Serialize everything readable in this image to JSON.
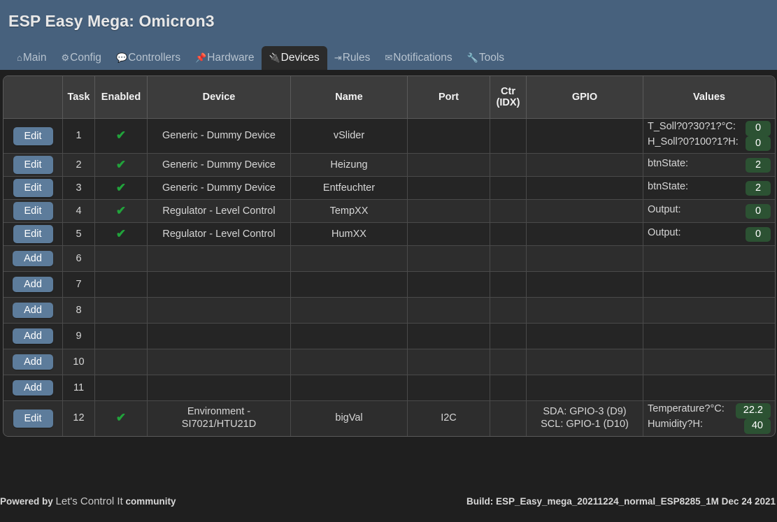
{
  "header": {
    "title": "ESP Easy Mega: Omicron3",
    "nav": [
      {
        "label": "Main",
        "icon": "home-icon",
        "glyph": "⌂",
        "active": false
      },
      {
        "label": "Config",
        "icon": "gear-icon",
        "glyph": "⚙",
        "active": false
      },
      {
        "label": "Controllers",
        "icon": "speech-bubble-icon",
        "glyph": "💬",
        "active": false
      },
      {
        "label": "Hardware",
        "icon": "pushpin-icon",
        "glyph": "📌",
        "active": false
      },
      {
        "label": "Devices",
        "icon": "plug-icon",
        "glyph": "🔌",
        "active": true
      },
      {
        "label": "Rules",
        "icon": "arrow-branch-icon",
        "glyph": "⇥",
        "active": false
      },
      {
        "label": "Notifications",
        "icon": "envelope-icon",
        "glyph": "✉",
        "active": false
      },
      {
        "label": "Tools",
        "icon": "wrench-icon",
        "glyph": "🔧",
        "active": false
      }
    ]
  },
  "table": {
    "columns": [
      {
        "key": "action",
        "label": ""
      },
      {
        "key": "task",
        "label": "Task"
      },
      {
        "key": "enabled",
        "label": "Enabled"
      },
      {
        "key": "device",
        "label": "Device"
      },
      {
        "key": "name",
        "label": "Name"
      },
      {
        "key": "port",
        "label": "Port"
      },
      {
        "key": "ctr",
        "label": "Ctr\n(IDX)"
      },
      {
        "key": "gpio",
        "label": "GPIO"
      },
      {
        "key": "values",
        "label": "Values"
      }
    ],
    "ctr_label_line1": "Ctr",
    "ctr_label_line2": "(IDX)",
    "edit_label": "Edit",
    "add_label": "Add",
    "check_glyph": "✔",
    "rows": [
      {
        "action": "Edit",
        "task": "1",
        "enabled": true,
        "device": "Generic - Dummy Device",
        "name": "vSlider",
        "port": "",
        "ctr": "",
        "gpio": "",
        "values": [
          {
            "label": "T_Soll?0?30?1?°C:",
            "value": "0"
          },
          {
            "label": "H_Soll?0?100?1?H:",
            "value": "0"
          }
        ]
      },
      {
        "action": "Edit",
        "task": "2",
        "enabled": true,
        "device": "Generic - Dummy Device",
        "name": "Heizung",
        "port": "",
        "ctr": "",
        "gpio": "",
        "values": [
          {
            "label": "btnState:",
            "value": "2"
          }
        ]
      },
      {
        "action": "Edit",
        "task": "3",
        "enabled": true,
        "device": "Generic - Dummy Device",
        "name": "Entfeuchter",
        "port": "",
        "ctr": "",
        "gpio": "",
        "values": [
          {
            "label": "btnState:",
            "value": "2"
          }
        ]
      },
      {
        "action": "Edit",
        "task": "4",
        "enabled": true,
        "device": "Regulator - Level Control",
        "name": "TempXX",
        "port": "",
        "ctr": "",
        "gpio": "",
        "values": [
          {
            "label": "Output:",
            "value": "0"
          }
        ]
      },
      {
        "action": "Edit",
        "task": "5",
        "enabled": true,
        "device": "Regulator - Level Control",
        "name": "HumXX",
        "port": "",
        "ctr": "",
        "gpio": "",
        "values": [
          {
            "label": "Output:",
            "value": "0"
          }
        ]
      },
      {
        "action": "Add",
        "task": "6",
        "enabled": false,
        "device": "",
        "name": "",
        "port": "",
        "ctr": "",
        "gpio": "",
        "values": []
      },
      {
        "action": "Add",
        "task": "7",
        "enabled": false,
        "device": "",
        "name": "",
        "port": "",
        "ctr": "",
        "gpio": "",
        "values": []
      },
      {
        "action": "Add",
        "task": "8",
        "enabled": false,
        "device": "",
        "name": "",
        "port": "",
        "ctr": "",
        "gpio": "",
        "values": []
      },
      {
        "action": "Add",
        "task": "9",
        "enabled": false,
        "device": "",
        "name": "",
        "port": "",
        "ctr": "",
        "gpio": "",
        "values": []
      },
      {
        "action": "Add",
        "task": "10",
        "enabled": false,
        "device": "",
        "name": "",
        "port": "",
        "ctr": "",
        "gpio": "",
        "values": []
      },
      {
        "action": "Add",
        "task": "11",
        "enabled": false,
        "device": "",
        "name": "",
        "port": "",
        "ctr": "",
        "gpio": "",
        "values": []
      },
      {
        "action": "Edit",
        "task": "12",
        "enabled": true,
        "device": "Environment - SI7021/HTU21D",
        "name": "bigVal",
        "port": "I2C",
        "ctr": "",
        "gpio": "SDA: GPIO-3 (D9)\nSCL: GPIO-1 (D10)",
        "gpio_lines": [
          "SDA: GPIO-3 (D9)",
          "SCL: GPIO-1 (D10)"
        ],
        "values": [
          {
            "label": "Temperature?°C:",
            "value": "22.2"
          },
          {
            "label": "Humidity?H:",
            "value": "40"
          }
        ]
      }
    ]
  },
  "footer": {
    "powered_by": "Powered by ",
    "brand": "Let's Control It",
    "community": " community",
    "build": "Build: ESP_Easy_mega_20211224_normal_ESP8285_1M Dec 24 2021"
  },
  "colors": {
    "header_bg": "#47617d",
    "page_bg": "#1f1f1f",
    "table_header_bg": "#3c3c3c",
    "button_bg": "#5d7c9b",
    "badge_bg": "#2c5233",
    "check_green": "#21a33b"
  }
}
